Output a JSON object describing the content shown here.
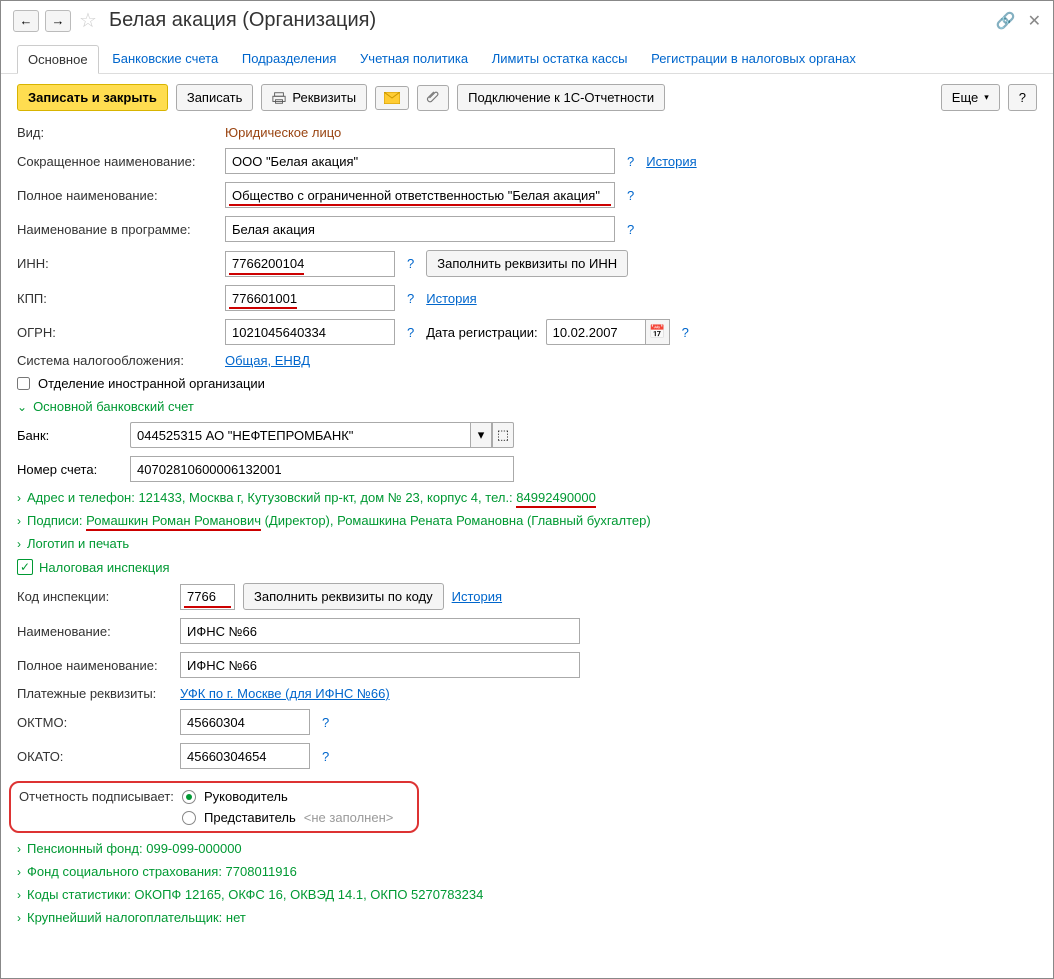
{
  "header": {
    "title": "Белая акация (Организация)"
  },
  "tabs": {
    "main": "Основное",
    "bank_accounts": "Банковские счета",
    "departments": "Подразделения",
    "accounting_policy": "Учетная политика",
    "cash_limits": "Лимиты остатка кассы",
    "tax_registrations": "Регистрации в налоговых органах"
  },
  "toolbar": {
    "save_close": "Записать и закрыть",
    "save": "Записать",
    "props": "Реквизиты",
    "connect_1c": "Подключение к 1С-Отчетности",
    "more": "Еще",
    "help": "?"
  },
  "form": {
    "kind_label": "Вид:",
    "kind_value": "Юридическое лицо",
    "short_name_label": "Сокращенное наименование:",
    "short_name_value": "ООО \"Белая акация\"",
    "history": "История",
    "full_name_label": "Полное наименование:",
    "full_name_value": "Общество с ограниченной ответственностью \"Белая акация\"",
    "program_name_label": "Наименование в программе:",
    "program_name_value": "Белая акация",
    "inn_label": "ИНН:",
    "inn_value": "7766200104",
    "fill_by_inn": "Заполнить реквизиты по ИНН",
    "kpp_label": "КПП:",
    "kpp_value": "776601001",
    "ogrn_label": "ОГРН:",
    "ogrn_value": "1021045640334",
    "reg_date_label": "Дата регистрации:",
    "reg_date_value": "10.02.2007",
    "tax_system_label": "Система налогообложения:",
    "tax_system_value": "Общая, ЕНВД",
    "foreign_branch": "Отделение иностранной организации",
    "main_bank_account": "Основной банковский счет",
    "bank_label": "Банк:",
    "bank_value": "044525315 АО \"НЕФТЕПРОМБАНК\"",
    "account_label": "Номер счета:",
    "account_value": "40702810600006132001",
    "address_phone_label": "Адрес и телефон: ",
    "address_phone_rest": "121433, Москва г, Кутузовский пр-кт, дом № 23, корпус 4, тел.: ",
    "address_phone_tel": "84992490000",
    "signatures_label": "Подписи: ",
    "signatures_p1": "Ромашкин Роман Романович",
    "signatures_p2": " (Директор), Ромашкина Рената Романовна (Главный бухгалтер)",
    "logo_stamp": "Логотип и печать",
    "tax_inspection": "Налоговая инспекция",
    "inspection_code_label": "Код инспекции:",
    "inspection_code_value": "7766",
    "fill_by_code": "Заполнить реквизиты по коду",
    "inspection_name_label": "Наименование:",
    "inspection_name_value": "ИФНС №66",
    "inspection_full_label": "Полное наименование:",
    "inspection_full_value": "ИФНС №66",
    "payment_details_label": "Платежные реквизиты:",
    "payment_details_value": "УФК по г. Москве (для ИФНС №66)",
    "oktmo_label": "ОКТМО:",
    "oktmo_value": "45660304",
    "okato_label": "ОКАТО:",
    "okato_value": "45660304654",
    "report_signer_label": "Отчетность подписывает:",
    "signer_head": "Руководитель",
    "signer_rep": "Представитель",
    "not_filled": "<не заполнен>",
    "pension_fund": "Пенсионный фонд: 099-099-000000",
    "fss": "Фонд социального страхования: 7708011916",
    "stat_codes": "Коды статистики: ОКОПФ 12165, ОКФС 16, ОКВЭД 14.1, ОКПО 5270783234",
    "main_taxpayer": "Крупнейший налогоплательщик: нет"
  }
}
